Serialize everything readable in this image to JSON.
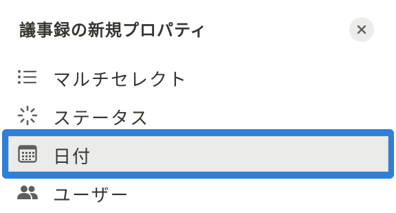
{
  "panel": {
    "title": "議事録の新規プロパティ",
    "close_icon": "close-icon"
  },
  "property_types": [
    {
      "label": "マルチセレクト",
      "icon": "list-icon"
    },
    {
      "label": "ステータス",
      "icon": "status-loader-icon"
    },
    {
      "label": "日付",
      "icon": "calendar-icon",
      "selected": true
    },
    {
      "label": "ユーザー",
      "icon": "people-icon"
    }
  ],
  "colors": {
    "selection_outline": "#2f7fd8",
    "selected_background": "#ebebea",
    "text": "#37352f",
    "icon": "#5f5e5b",
    "close_button_bg": "#ececeb"
  }
}
